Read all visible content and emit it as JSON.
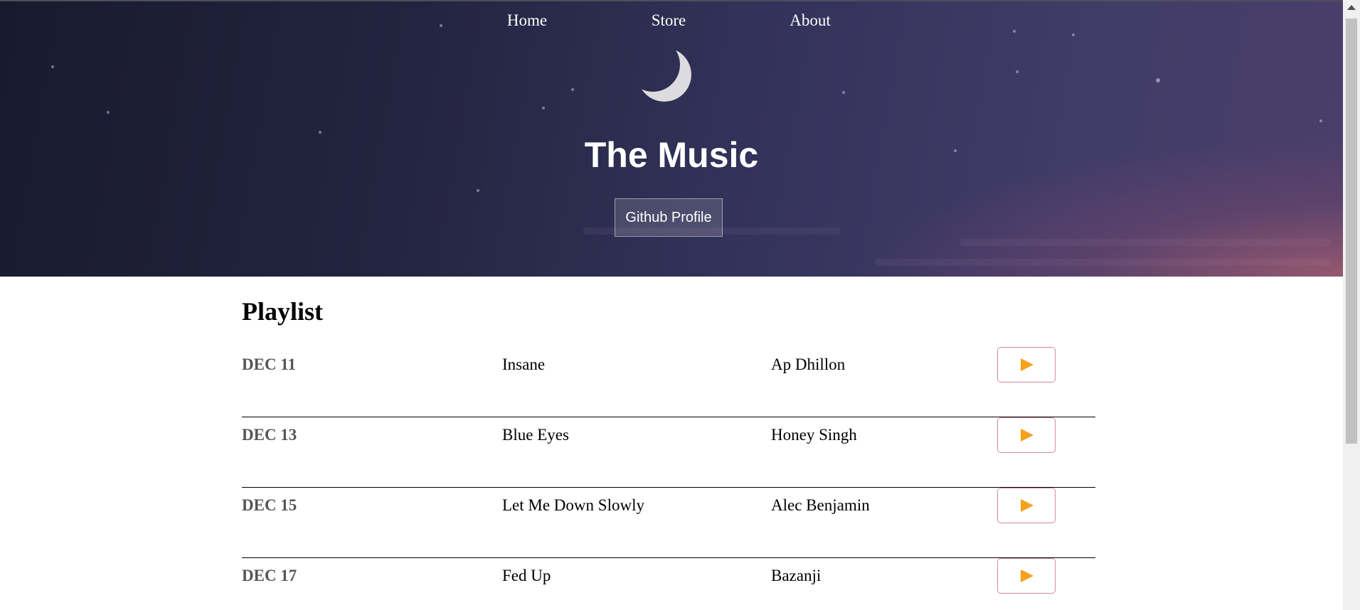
{
  "nav": {
    "items": [
      {
        "label": "Home"
      },
      {
        "label": "Store"
      },
      {
        "label": "About"
      }
    ]
  },
  "hero": {
    "icon": "crescent-moon-icon",
    "title": "The Music",
    "button_label": "Github Profile"
  },
  "playlist": {
    "title": "Playlist",
    "rows": [
      {
        "date": "DEC 11",
        "song": "Insane",
        "artist": "Ap Dhillon"
      },
      {
        "date": "DEC 13",
        "song": "Blue Eyes",
        "artist": "Honey Singh"
      },
      {
        "date": "DEC 15",
        "song": "Let Me Down Slowly",
        "artist": "Alec Benjamin"
      },
      {
        "date": "DEC 17",
        "song": "Fed Up",
        "artist": "Bazanji"
      }
    ],
    "play_icon": "play-icon"
  },
  "colors": {
    "play_icon": "#f4a11c",
    "play_button_border": "#d48a98",
    "date_text": "#555555",
    "hero_bg_dark": "#181a2f",
    "hero_glow": "#9a5a6e"
  }
}
